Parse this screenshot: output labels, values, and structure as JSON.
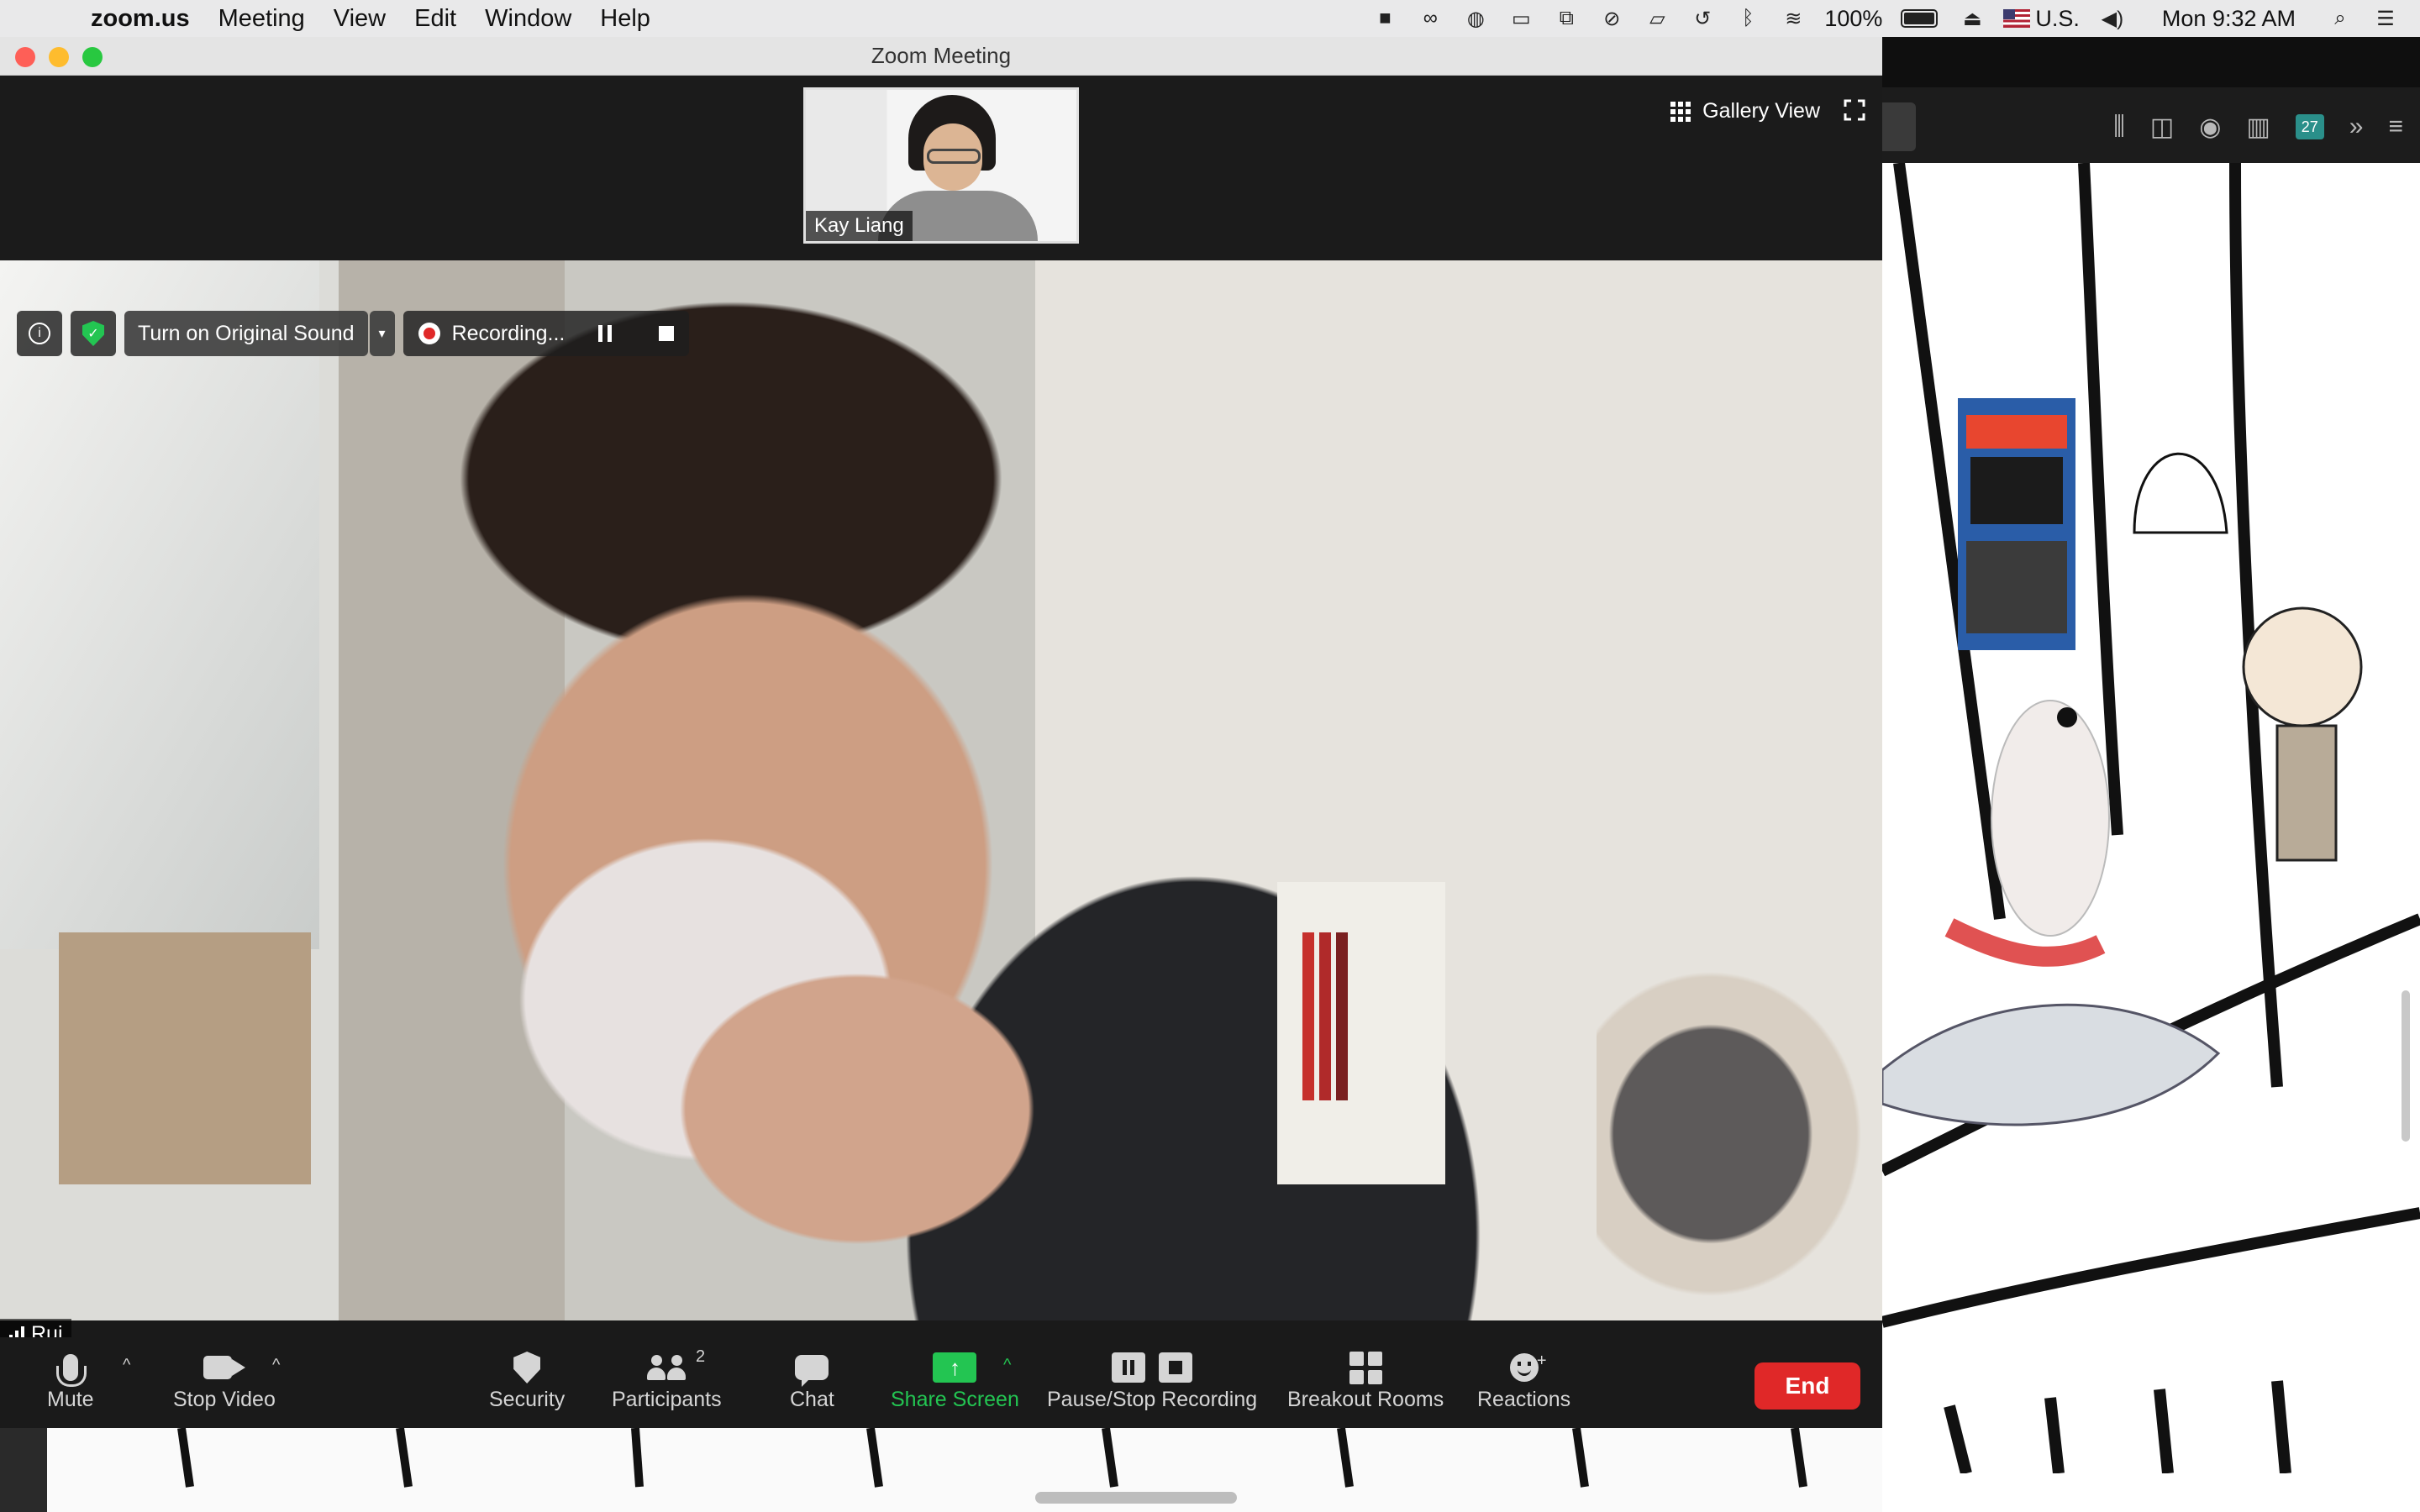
{
  "menubar": {
    "app_name": "zoom.us",
    "menus": [
      "Meeting",
      "View",
      "Edit",
      "Window",
      "Help"
    ],
    "battery": "100%",
    "input_source": "U.S.",
    "clock": "Mon 9:32 AM"
  },
  "window": {
    "title": "Zoom Meeting"
  },
  "gallery": {
    "label": "Gallery View"
  },
  "thumbnail": {
    "name": "Kay Liang"
  },
  "video_controls": {
    "original_sound": "Turn on Original Sound",
    "recording": "Recording..."
  },
  "speaker": {
    "name": "Rui"
  },
  "toolbar": {
    "mute": "Mute",
    "stop_video": "Stop Video",
    "security": "Security",
    "participants": "Participants",
    "participants_count": "2",
    "chat": "Chat",
    "share_screen": "Share Screen",
    "pause_stop_recording": "Pause/Stop Recording",
    "breakout_rooms": "Breakout Rooms",
    "reactions": "Reactions",
    "end": "End"
  },
  "browser": {
    "calendar_badge": "27"
  },
  "colors": {
    "zoom_green": "#23c552",
    "end_red": "#e02828",
    "toolbar_bg": "#1a1a1a"
  }
}
